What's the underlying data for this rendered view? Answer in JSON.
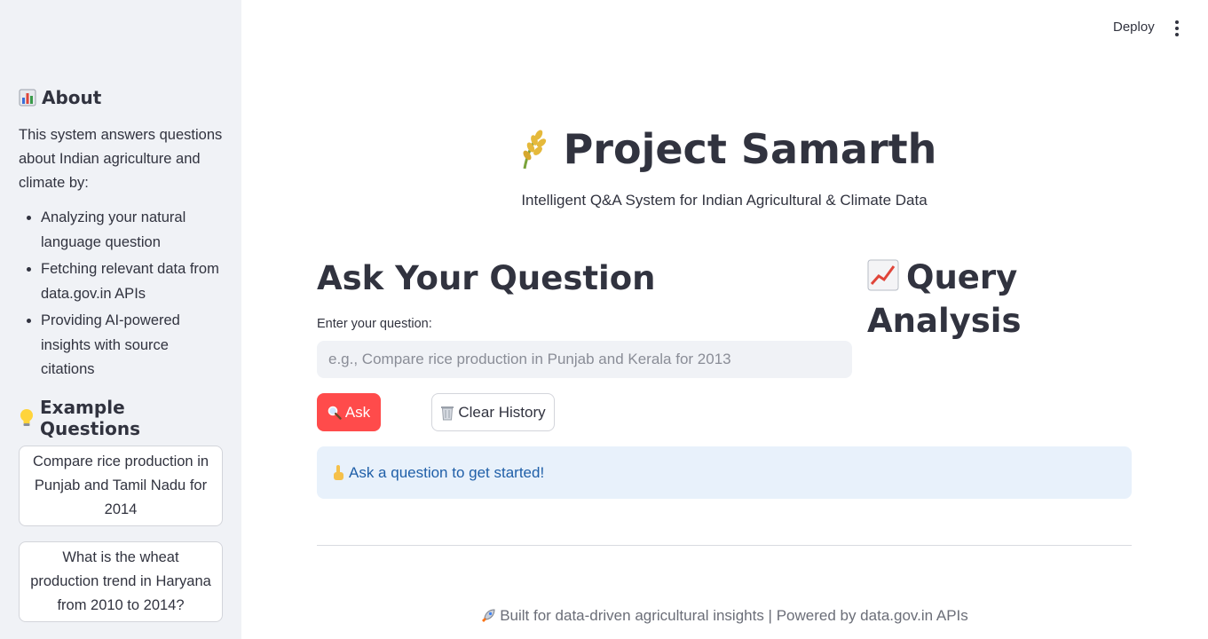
{
  "toolbar": {
    "deploy_label": "Deploy",
    "menu_icon": "vertical-dots-icon"
  },
  "sidebar": {
    "about_heading": "About",
    "about_icon": "bar-chart-icon",
    "about_text": "This system answers questions about Indian agriculture and climate by:",
    "bullets": [
      "Analyzing your natural language question",
      "Fetching relevant data from data.gov.in APIs",
      "Providing AI-powered insights with source citations"
    ],
    "examples_heading": "Example Questions",
    "examples_icon": "light-bulb-icon",
    "examples": [
      "Compare rice production in Punjab and Tamil Nadu for 2014",
      "What is the wheat production trend in Haryana from 2010 to 2014?"
    ]
  },
  "header": {
    "title": "Project Samarth",
    "title_icon": "rice-stalk-icon",
    "subtitle": "Intelligent Q&A System for Indian Agricultural & Climate Data"
  },
  "main": {
    "ask_heading": "Ask Your Question",
    "question_label": "Enter your question:",
    "question_value": "",
    "question_placeholder": "e.g., Compare rice production in Punjab and Kerala for 2013",
    "ask_button": "Ask",
    "ask_icon": "magnifier-icon",
    "clear_button": "Clear History",
    "clear_icon": "wastebasket-icon",
    "info_message": "Ask a question to get started!",
    "info_icon": "pointing-hand-icon"
  },
  "analysis": {
    "heading": "Query Analysis",
    "icon": "trend-chart-icon"
  },
  "footer": {
    "text": "Built for data-driven agricultural insights | Powered by data.gov.in APIs",
    "icon": "rocket-icon"
  },
  "colors": {
    "primary": "#ff4b4b",
    "sidebar_bg": "#f0f2f6",
    "info_bg": "#e8f1fb",
    "info_text": "#1f5fa8"
  }
}
